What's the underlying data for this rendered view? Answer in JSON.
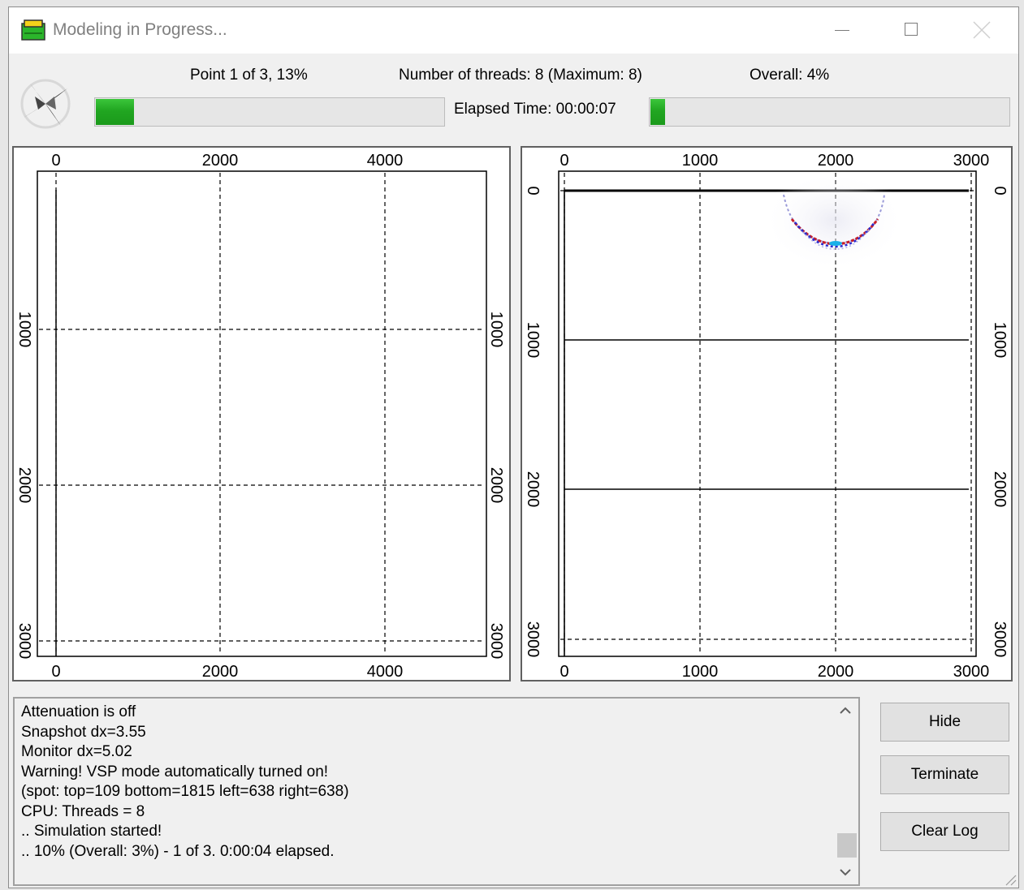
{
  "window": {
    "title": "Modeling in Progress..."
  },
  "header": {
    "point_status": "Point 1 of 3, 13%",
    "threads": "Number of threads: 8 (Maximum: 8)",
    "overall": "Overall: 4%",
    "elapsed": "Elapsed Time: 00:00:07",
    "point_progress": 0.11,
    "overall_progress": 0.04
  },
  "plots": {
    "left": {
      "x_ticks": [
        "0",
        "2000",
        "4000"
      ],
      "y_ticks": [
        "1000",
        "2000",
        "3000"
      ]
    },
    "right": {
      "x_ticks": [
        "0",
        "1000",
        "2000",
        "3000"
      ],
      "y_ticks": [
        "0",
        "1000",
        "2000",
        "3000"
      ]
    }
  },
  "log": {
    "lines": [
      "Attenuation is off",
      "Snapshot dx=3.55",
      "Monitor dx=5.02",
      "Warning! VSP mode automatically turned on!",
      "(spot: top=109 bottom=1815 left=638 right=638)",
      "CPU: Threads = 8",
      ".. Simulation started!",
      ".. 10% (Overall: 3%) - 1 of 3.   0:00:04 elapsed."
    ]
  },
  "buttons": {
    "hide": "Hide",
    "terminate": "Terminate",
    "clear_log": "Clear Log"
  },
  "colors": {
    "progress_green": "#21a621",
    "wave_red": "#c81e28",
    "wave_blue": "#2a2ad0"
  }
}
